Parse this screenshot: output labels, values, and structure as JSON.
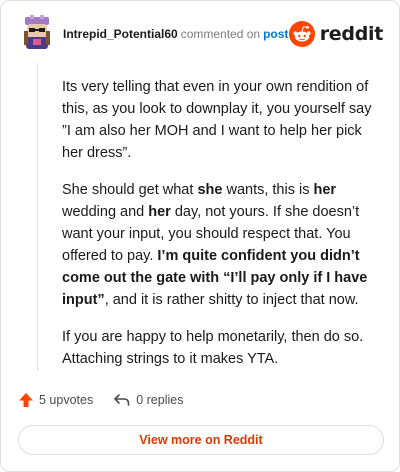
{
  "header": {
    "username": "Intrepid_Potential60",
    "commented_on": "commented on",
    "post_link": "post",
    "brand": "reddit",
    "brand_color": "#ff4500"
  },
  "comment": {
    "p1": "Its very telling that even in your own rendition of this, as you look to downplay it, you yourself say ”I am also her MOH and I want to help her pick her dress”.",
    "p2": [
      {
        "t": "She should get what ",
        "b": false
      },
      {
        "t": "she",
        "b": true
      },
      {
        "t": " wants, this is ",
        "b": false
      },
      {
        "t": "her",
        "b": true
      },
      {
        "t": " wedding and ",
        "b": false
      },
      {
        "t": "her",
        "b": true
      },
      {
        "t": " day, not yours. If she doesn’t want your input, you should respect that. You offered to pay. ",
        "b": false
      },
      {
        "t": "I’m quite confident you didn’t come out the gate with “I’ll pay only if I have input”",
        "b": true
      },
      {
        "t": ", and it is rather shitty to inject that now.",
        "b": false
      }
    ],
    "p3": "If you are happy to help monetarily, then do so. Attaching strings to it makes YTA."
  },
  "actions": {
    "upvotes": "5 upvotes",
    "replies": "0 replies",
    "upvote_icon": "arrow-up-icon",
    "reply_icon": "reply-arrow-icon",
    "upvote_color": "#ff4500"
  },
  "footer": {
    "view_more": "View more on Reddit",
    "view_more_color": "#d93a00"
  }
}
